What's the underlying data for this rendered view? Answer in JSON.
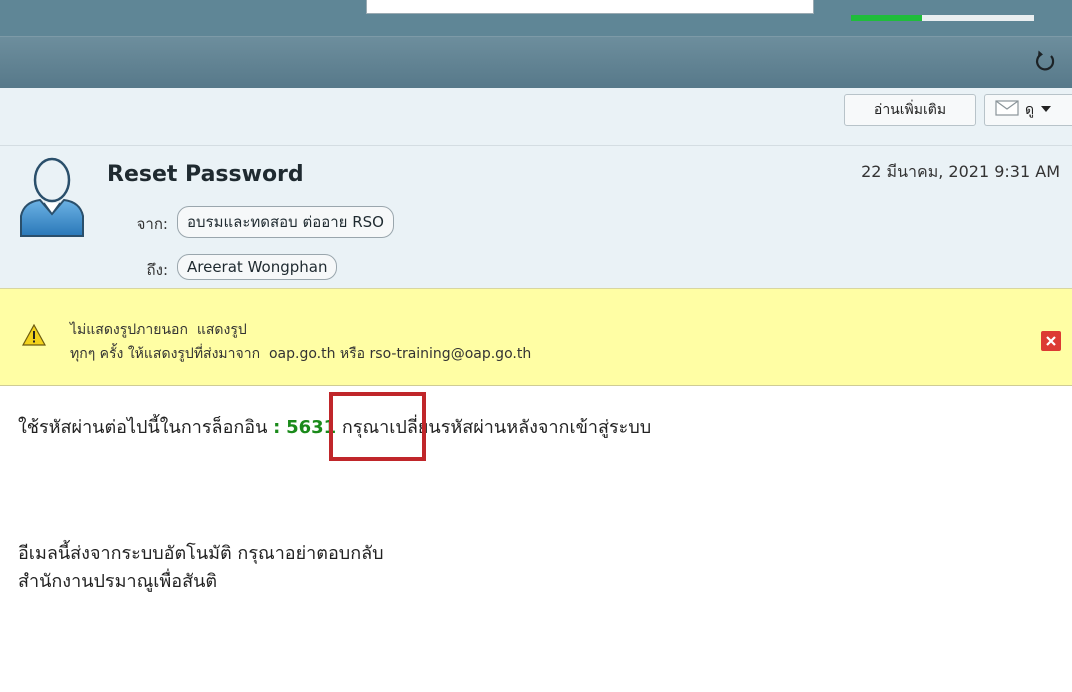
{
  "toolbar": {
    "read_more_label": "อ่านเพิ่มเติม",
    "view_label": "ดู",
    "progress_fraction": 0.39
  },
  "message": {
    "subject": "Reset Password",
    "date": "22 มีนาคม, 2021 9:31 AM",
    "from_label": "จาก:",
    "from": "อบรมและทดสอบ ต่ออาย RSO",
    "to_label": "ถึง:",
    "to": "Areerat Wongphan"
  },
  "warning": {
    "line1_prefix": "ไม่แสดงรูปภายนอก",
    "show_images": "แสดงรูป",
    "line2_prefix": "ทุกๆ ครั้ง ให้แสดงรูปที่ส่งมาจาก",
    "sender_domain": "oap.go.th",
    "or": "หรือ",
    "sender_email": "rso-training@oap.go.th"
  },
  "body": {
    "line1_before": "ใช้รหัสผ่านต่อไปนี้ในการล็อกอิน",
    "separator": ":",
    "code": "5631",
    "line1_after": "กรุณาเปลี่ยนรหัสผ่านหลังจากเข้าสู่ระบบ",
    "footer_line1": "อีเมลนี้ส่งจากระบบอัตโนมัติ กรุณาอย่าตอบกลับ",
    "footer_line2": "สำนักงานปรมาณูเพื่อสันติ"
  },
  "icons": {
    "refresh": "refresh-icon",
    "envelope": "envelope-icon",
    "warning": "warning-icon",
    "close": "close-icon",
    "avatar": "user-avatar-icon"
  },
  "colors": {
    "accent_green": "#1fbd3b",
    "warning_bg": "#fffea4",
    "code_green": "#1a8a1a",
    "highlight_red": "#c0262a"
  }
}
